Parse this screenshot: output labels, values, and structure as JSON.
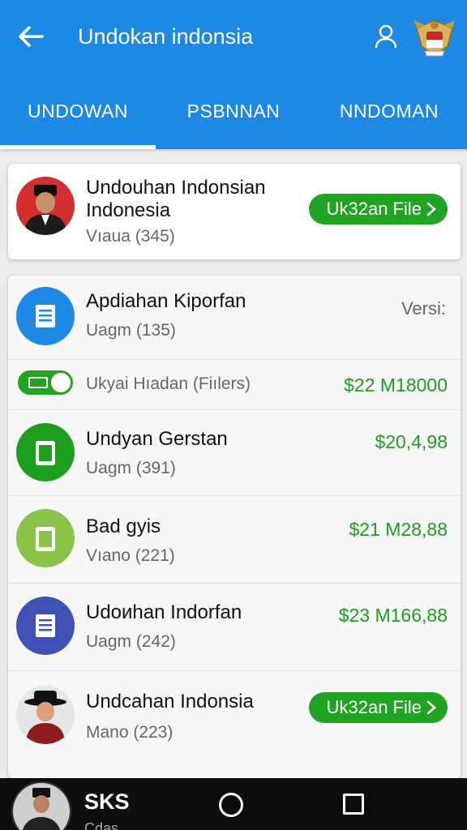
{
  "app_bar": {
    "title": "Undokan indonsia"
  },
  "tabs": [
    {
      "label": "UNDOWAN",
      "active": true
    },
    {
      "label": "PSBNNAN",
      "active": false
    },
    {
      "label": "NNDOMAN",
      "active": false
    }
  ],
  "featured": {
    "title_line1": "Undouhan Indonsian",
    "title_line2": "Indonesia",
    "subtitle": "Vıaua (345)",
    "button": "Uk32an File"
  },
  "list": {
    "item1": {
      "title": "Apdiahan Kiporfan",
      "subtitle": "Uagm (135)",
      "trailing": "Versi:",
      "icon_color": "#1e88e5"
    },
    "item2": {
      "title": "Ukyai Hıadan (Fiılers)",
      "price": "$22 M18000"
    },
    "item3": {
      "title": "Undyan Gerstan",
      "subtitle": "Uagm (391)",
      "price": "$20,4,98",
      "icon_color": "#1e9e1e"
    },
    "item4": {
      "title": "Bad gyis",
      "subtitle": "Vıano (221)",
      "price": "$21 M28,88",
      "icon_color": "#8bc34a"
    },
    "item5": {
      "title": "Udoиhan Indorfan",
      "subtitle": "Uagm (242)",
      "price": "$23 M166,88",
      "icon_color": "#3f51b5"
    },
    "item6": {
      "title": "Undcahan Indonsia",
      "subtitle": "Mano (223)",
      "button": "Uk32an File"
    }
  },
  "nav_bar": {
    "label": "SKS",
    "sub": "Cdas"
  },
  "colors": {
    "primary": "#1e88e5",
    "accent_green": "#21a324"
  }
}
